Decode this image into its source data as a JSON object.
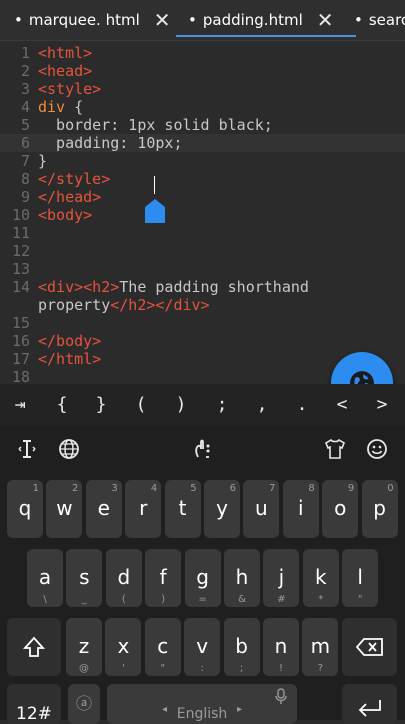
{
  "tabs": [
    {
      "label": "marquee. html",
      "active": false
    },
    {
      "label": "padding.html",
      "active": true
    },
    {
      "label": "searc",
      "active": false
    }
  ],
  "tab_close_glyph": "✕",
  "tab_dot": "•",
  "editor": {
    "lines": [
      {
        "n": "1",
        "text": "<html>"
      },
      {
        "n": "2",
        "text": "<head>"
      },
      {
        "n": "3",
        "text": "<style>"
      },
      {
        "n": "4",
        "text": "div {"
      },
      {
        "n": "5",
        "text": "  border: 1px solid black;"
      },
      {
        "n": "6",
        "text": "  padding: 10px;"
      },
      {
        "n": "7",
        "text": "}"
      },
      {
        "n": "8",
        "text": "</style>"
      },
      {
        "n": "9",
        "text": "</head>"
      },
      {
        "n": "10",
        "text": "<body>"
      },
      {
        "n": "11",
        "text": ""
      },
      {
        "n": "12",
        "text": ""
      },
      {
        "n": "13",
        "text": ""
      },
      {
        "n": "14",
        "text": "<div><h2>The padding shorthand"
      },
      {
        "n": "",
        "text": "property</h2></div>"
      },
      {
        "n": "15",
        "text": ""
      },
      {
        "n": "16",
        "text": "</body>"
      },
      {
        "n": "17",
        "text": "</html>"
      },
      {
        "n": "18",
        "text": ""
      }
    ]
  },
  "symbols": [
    "⇥",
    "{",
    "}",
    "(",
    ")",
    ";",
    ",",
    ".",
    "<",
    ">"
  ],
  "keyboard": {
    "row1": [
      {
        "k": "q",
        "alt": "1"
      },
      {
        "k": "w",
        "alt": "2"
      },
      {
        "k": "e",
        "alt": "3"
      },
      {
        "k": "r",
        "alt": "4"
      },
      {
        "k": "t",
        "alt": "5"
      },
      {
        "k": "y",
        "alt": "6"
      },
      {
        "k": "u",
        "alt": "7"
      },
      {
        "k": "i",
        "alt": "8"
      },
      {
        "k": "o",
        "alt": "9"
      },
      {
        "k": "p",
        "alt": "0"
      }
    ],
    "row2": [
      {
        "k": "a",
        "alt": "\\"
      },
      {
        "k": "s",
        "alt": "_"
      },
      {
        "k": "d",
        "alt": "("
      },
      {
        "k": "f",
        "alt": ")"
      },
      {
        "k": "g",
        "alt": "="
      },
      {
        "k": "h",
        "alt": "&"
      },
      {
        "k": "j",
        "alt": "#"
      },
      {
        "k": "k",
        "alt": "*"
      },
      {
        "k": "l",
        "alt": "\""
      }
    ],
    "row3": [
      {
        "k": "z",
        "alt": "@"
      },
      {
        "k": "x",
        "alt": "'"
      },
      {
        "k": "c",
        "alt": "\""
      },
      {
        "k": "v",
        "alt": ":"
      },
      {
        "k": "b",
        "alt": ";"
      },
      {
        "k": "n",
        "alt": "!"
      },
      {
        "k": "m",
        "alt": "?"
      }
    ],
    "numbers_key": "12#",
    "space_label": "English",
    "space_lang_glyph": "ⓐ"
  },
  "colors": {
    "accent": "#2d8cf0",
    "tag": "#e5533d",
    "selector": "#f08a3c"
  }
}
